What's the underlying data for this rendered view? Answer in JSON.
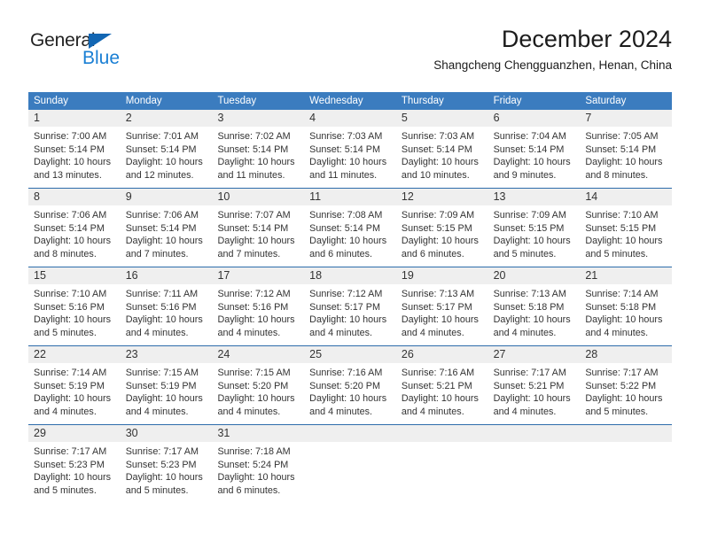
{
  "brand": {
    "name_top": "General",
    "name_bottom": "Blue",
    "triangle_color": "#1266b3",
    "blue_color": "#1a7fd4"
  },
  "header": {
    "title": "December 2024",
    "subtitle": "Shangcheng Chengguanzhen, Henan, China"
  },
  "theme": {
    "header_blue": "#3b7cbf",
    "row_separator_blue": "#2d6cab",
    "day_band_gray": "#efefef",
    "text_color": "#333333"
  },
  "calendar": {
    "weekdays": [
      "Sunday",
      "Monday",
      "Tuesday",
      "Wednesday",
      "Thursday",
      "Friday",
      "Saturday"
    ],
    "weeks": [
      [
        {
          "day": "1",
          "sunrise": "Sunrise: 7:00 AM",
          "sunset": "Sunset: 5:14 PM",
          "daylight1": "Daylight: 10 hours",
          "daylight2": "and 13 minutes."
        },
        {
          "day": "2",
          "sunrise": "Sunrise: 7:01 AM",
          "sunset": "Sunset: 5:14 PM",
          "daylight1": "Daylight: 10 hours",
          "daylight2": "and 12 minutes."
        },
        {
          "day": "3",
          "sunrise": "Sunrise: 7:02 AM",
          "sunset": "Sunset: 5:14 PM",
          "daylight1": "Daylight: 10 hours",
          "daylight2": "and 11 minutes."
        },
        {
          "day": "4",
          "sunrise": "Sunrise: 7:03 AM",
          "sunset": "Sunset: 5:14 PM",
          "daylight1": "Daylight: 10 hours",
          "daylight2": "and 11 minutes."
        },
        {
          "day": "5",
          "sunrise": "Sunrise: 7:03 AM",
          "sunset": "Sunset: 5:14 PM",
          "daylight1": "Daylight: 10 hours",
          "daylight2": "and 10 minutes."
        },
        {
          "day": "6",
          "sunrise": "Sunrise: 7:04 AM",
          "sunset": "Sunset: 5:14 PM",
          "daylight1": "Daylight: 10 hours",
          "daylight2": "and 9 minutes."
        },
        {
          "day": "7",
          "sunrise": "Sunrise: 7:05 AM",
          "sunset": "Sunset: 5:14 PM",
          "daylight1": "Daylight: 10 hours",
          "daylight2": "and 8 minutes."
        }
      ],
      [
        {
          "day": "8",
          "sunrise": "Sunrise: 7:06 AM",
          "sunset": "Sunset: 5:14 PM",
          "daylight1": "Daylight: 10 hours",
          "daylight2": "and 8 minutes."
        },
        {
          "day": "9",
          "sunrise": "Sunrise: 7:06 AM",
          "sunset": "Sunset: 5:14 PM",
          "daylight1": "Daylight: 10 hours",
          "daylight2": "and 7 minutes."
        },
        {
          "day": "10",
          "sunrise": "Sunrise: 7:07 AM",
          "sunset": "Sunset: 5:14 PM",
          "daylight1": "Daylight: 10 hours",
          "daylight2": "and 7 minutes."
        },
        {
          "day": "11",
          "sunrise": "Sunrise: 7:08 AM",
          "sunset": "Sunset: 5:14 PM",
          "daylight1": "Daylight: 10 hours",
          "daylight2": "and 6 minutes."
        },
        {
          "day": "12",
          "sunrise": "Sunrise: 7:09 AM",
          "sunset": "Sunset: 5:15 PM",
          "daylight1": "Daylight: 10 hours",
          "daylight2": "and 6 minutes."
        },
        {
          "day": "13",
          "sunrise": "Sunrise: 7:09 AM",
          "sunset": "Sunset: 5:15 PM",
          "daylight1": "Daylight: 10 hours",
          "daylight2": "and 5 minutes."
        },
        {
          "day": "14",
          "sunrise": "Sunrise: 7:10 AM",
          "sunset": "Sunset: 5:15 PM",
          "daylight1": "Daylight: 10 hours",
          "daylight2": "and 5 minutes."
        }
      ],
      [
        {
          "day": "15",
          "sunrise": "Sunrise: 7:10 AM",
          "sunset": "Sunset: 5:16 PM",
          "daylight1": "Daylight: 10 hours",
          "daylight2": "and 5 minutes."
        },
        {
          "day": "16",
          "sunrise": "Sunrise: 7:11 AM",
          "sunset": "Sunset: 5:16 PM",
          "daylight1": "Daylight: 10 hours",
          "daylight2": "and 4 minutes."
        },
        {
          "day": "17",
          "sunrise": "Sunrise: 7:12 AM",
          "sunset": "Sunset: 5:16 PM",
          "daylight1": "Daylight: 10 hours",
          "daylight2": "and 4 minutes."
        },
        {
          "day": "18",
          "sunrise": "Sunrise: 7:12 AM",
          "sunset": "Sunset: 5:17 PM",
          "daylight1": "Daylight: 10 hours",
          "daylight2": "and 4 minutes."
        },
        {
          "day": "19",
          "sunrise": "Sunrise: 7:13 AM",
          "sunset": "Sunset: 5:17 PM",
          "daylight1": "Daylight: 10 hours",
          "daylight2": "and 4 minutes."
        },
        {
          "day": "20",
          "sunrise": "Sunrise: 7:13 AM",
          "sunset": "Sunset: 5:18 PM",
          "daylight1": "Daylight: 10 hours",
          "daylight2": "and 4 minutes."
        },
        {
          "day": "21",
          "sunrise": "Sunrise: 7:14 AM",
          "sunset": "Sunset: 5:18 PM",
          "daylight1": "Daylight: 10 hours",
          "daylight2": "and 4 minutes."
        }
      ],
      [
        {
          "day": "22",
          "sunrise": "Sunrise: 7:14 AM",
          "sunset": "Sunset: 5:19 PM",
          "daylight1": "Daylight: 10 hours",
          "daylight2": "and 4 minutes."
        },
        {
          "day": "23",
          "sunrise": "Sunrise: 7:15 AM",
          "sunset": "Sunset: 5:19 PM",
          "daylight1": "Daylight: 10 hours",
          "daylight2": "and 4 minutes."
        },
        {
          "day": "24",
          "sunrise": "Sunrise: 7:15 AM",
          "sunset": "Sunset: 5:20 PM",
          "daylight1": "Daylight: 10 hours",
          "daylight2": "and 4 minutes."
        },
        {
          "day": "25",
          "sunrise": "Sunrise: 7:16 AM",
          "sunset": "Sunset: 5:20 PM",
          "daylight1": "Daylight: 10 hours",
          "daylight2": "and 4 minutes."
        },
        {
          "day": "26",
          "sunrise": "Sunrise: 7:16 AM",
          "sunset": "Sunset: 5:21 PM",
          "daylight1": "Daylight: 10 hours",
          "daylight2": "and 4 minutes."
        },
        {
          "day": "27",
          "sunrise": "Sunrise: 7:17 AM",
          "sunset": "Sunset: 5:21 PM",
          "daylight1": "Daylight: 10 hours",
          "daylight2": "and 4 minutes."
        },
        {
          "day": "28",
          "sunrise": "Sunrise: 7:17 AM",
          "sunset": "Sunset: 5:22 PM",
          "daylight1": "Daylight: 10 hours",
          "daylight2": "and 5 minutes."
        }
      ],
      [
        {
          "day": "29",
          "sunrise": "Sunrise: 7:17 AM",
          "sunset": "Sunset: 5:23 PM",
          "daylight1": "Daylight: 10 hours",
          "daylight2": "and 5 minutes."
        },
        {
          "day": "30",
          "sunrise": "Sunrise: 7:17 AM",
          "sunset": "Sunset: 5:23 PM",
          "daylight1": "Daylight: 10 hours",
          "daylight2": "and 5 minutes."
        },
        {
          "day": "31",
          "sunrise": "Sunrise: 7:18 AM",
          "sunset": "Sunset: 5:24 PM",
          "daylight1": "Daylight: 10 hours",
          "daylight2": "and 6 minutes."
        },
        {
          "day": "",
          "sunrise": "",
          "sunset": "",
          "daylight1": "",
          "daylight2": ""
        },
        {
          "day": "",
          "sunrise": "",
          "sunset": "",
          "daylight1": "",
          "daylight2": ""
        },
        {
          "day": "",
          "sunrise": "",
          "sunset": "",
          "daylight1": "",
          "daylight2": ""
        },
        {
          "day": "",
          "sunrise": "",
          "sunset": "",
          "daylight1": "",
          "daylight2": ""
        }
      ]
    ]
  }
}
